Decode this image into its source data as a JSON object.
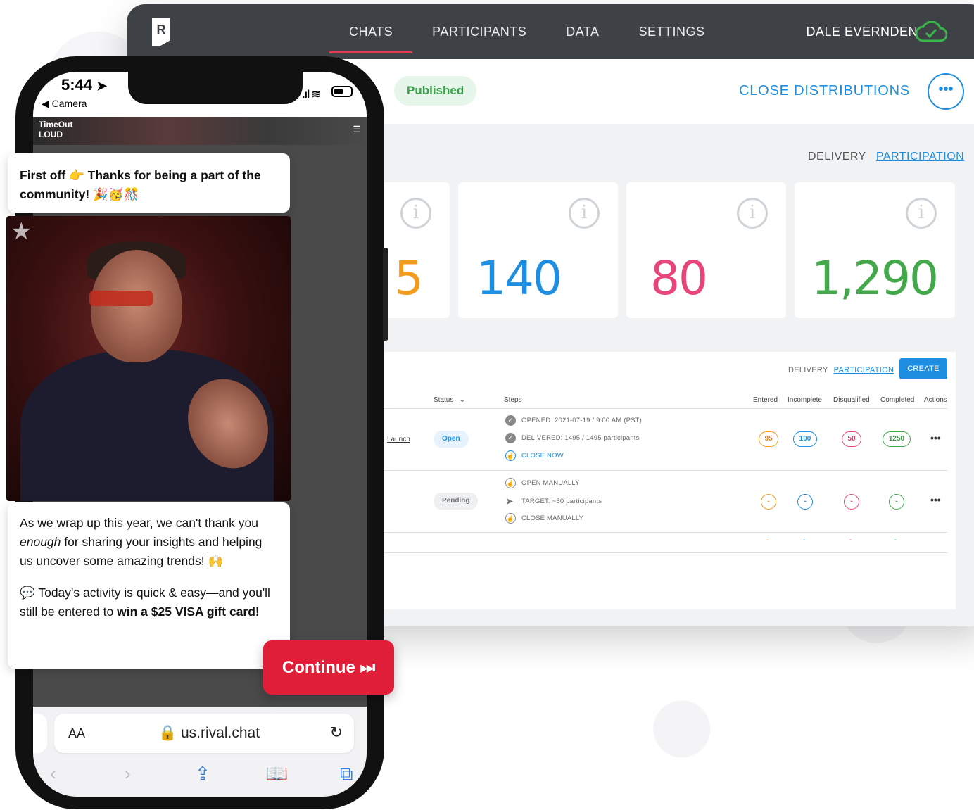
{
  "nav": {
    "tabs": [
      "CHATS",
      "PARTICIPANTS",
      "DATA",
      "SETTINGS"
    ],
    "active_tab": 0,
    "user": "DALE EVERNDEN",
    "logo_letter": "R"
  },
  "subbar": {
    "status": "Published",
    "close_label": "CLOSE DISTRIBUTIONS",
    "more_label": "•••"
  },
  "stats_toggle": {
    "delivery": "DELIVERY",
    "participation": "PARTICIPATION"
  },
  "stats": [
    {
      "value": "5",
      "color": "#f29b1c"
    },
    {
      "value": "140",
      "color": "#1e8ee0"
    },
    {
      "value": "80",
      "color": "#e8457a"
    },
    {
      "value": "1,290",
      "color": "#43a84a"
    }
  ],
  "table": {
    "toggle_delivery": "DELIVERY",
    "toggle_participation": "PARTICIPATION",
    "create_label": "CREATE",
    "headers": {
      "status": "Status",
      "steps": "Steps",
      "entered": "Entered",
      "incomplete": "Incomplete",
      "disqualified": "Disqualified",
      "completed": "Completed",
      "actions": "Actions"
    },
    "rows": [
      {
        "name": "Launch",
        "status": "Open",
        "steps": [
          "OPENED: 2021-07-19 / 9:00 AM (PST)",
          "DELIVERED:  1495 / 1495 participants",
          "CLOSE NOW"
        ],
        "entered": "95",
        "incomplete": "100",
        "disqualified": "50",
        "completed": "1250",
        "actions": "•••"
      },
      {
        "status": "Pending",
        "steps": [
          "OPEN MANUALLY",
          "TARGET: ~50 participants",
          "CLOSE MANUALLY"
        ],
        "entered": "-",
        "incomplete": "-",
        "disqualified": "-",
        "completed": "-",
        "actions": "•••"
      }
    ],
    "totals": [
      "-",
      "-",
      "-",
      "-"
    ]
  },
  "phone": {
    "time": "5:44",
    "back_label": "◀ Camera",
    "site_logo_line1": "TimeOut",
    "site_logo_line2": "LOUD",
    "bubble1": "First off 👉 Thanks for being a part of the community! 🎉🥳🎊",
    "bubble3_p1_a": "As we wrap up this year, we can't thank you ",
    "bubble3_p1_em": "enough",
    "bubble3_p1_b": " for sharing your insights and helping us uncover some amazing trends! 🙌",
    "bubble3_p2_a": "💬 Today's activity is quick & easy—and you'll still be entered to ",
    "bubble3_p2_strong": "win a $25 VISA gift card!",
    "continue_label": "Continue ⏭",
    "url": "🔒 us.rival.chat",
    "aa_label": "AA"
  },
  "colors": {
    "nav_bg": "#3e4247",
    "accent_red": "#e23a52",
    "accent_blue": "#1e8ee0",
    "continue_red": "#e01e37"
  }
}
